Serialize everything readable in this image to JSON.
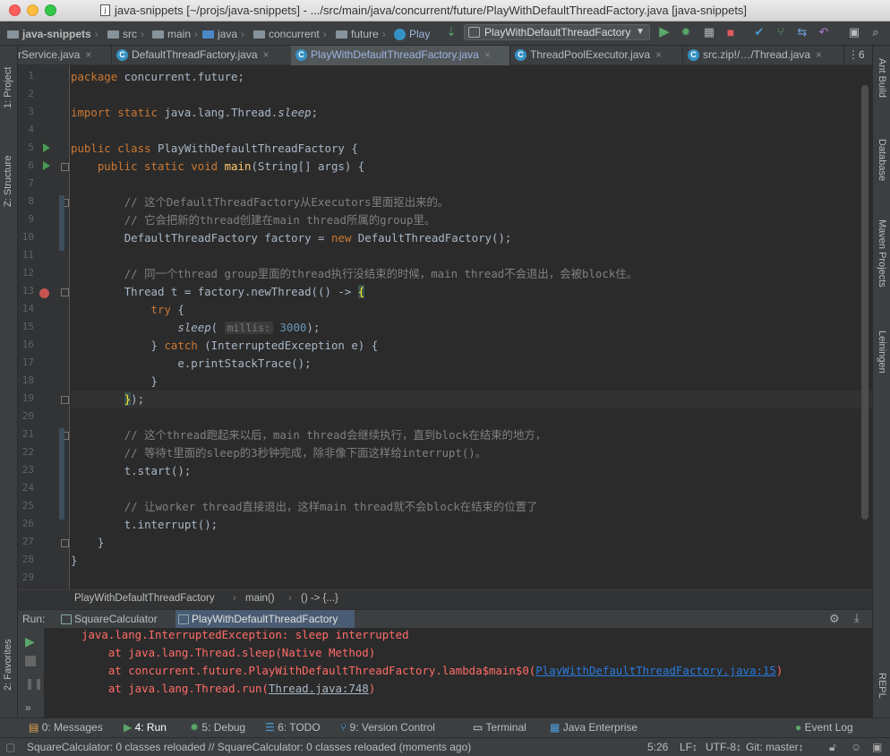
{
  "window": {
    "title": "java-snippets [~/projs/java-snippets] - .../src/main/java/concurrent/future/PlayWithDefaultThreadFactory.java [java-snippets]"
  },
  "navbar": {
    "crumbs": [
      "java-snippets",
      "src",
      "main",
      "java",
      "concurrent",
      "future",
      "Play"
    ],
    "run_config": "PlayWithDefaultThreadFactory"
  },
  "tabs": [
    {
      "label": "rService.java"
    },
    {
      "label": "DefaultThreadFactory.java"
    },
    {
      "label": "PlayWithDefaultThreadFactory.java",
      "active": true
    },
    {
      "label": "ThreadPoolExecutor.java"
    },
    {
      "label": "src.zip!/…/Thread.java"
    },
    {
      "label": "⋮6"
    }
  ],
  "left_strip": {
    "project": "1: Project",
    "structure": "Z: Structure",
    "favorites": "2: Favorites"
  },
  "right_strip": {
    "ant": "Ant Build",
    "database": "Database",
    "maven": "Maven Projects",
    "lein": "Leiningen",
    "repl": "REPL"
  },
  "editor": {
    "line_numbers": [
      "1",
      "2",
      "3",
      "4",
      "5",
      "6",
      "7",
      "8",
      "9",
      "10",
      "11",
      "12",
      "13",
      "14",
      "15",
      "16",
      "17",
      "18",
      "19",
      "20",
      "21",
      "22",
      "23",
      "24",
      "25",
      "26",
      "27",
      "28",
      "29"
    ],
    "code": {
      "l1_kw": "package",
      "l1_rest": " concurrent.future;",
      "l3_kw": "import static",
      "l3_rest": " java.lang.Thread.",
      "l3_it": "sleep",
      "l3_end": ";",
      "l5_kw": "public class",
      "l5_rest": " PlayWithDefaultThreadFactory {",
      "l6_kw": "public static void",
      "l6_fn": "main",
      "l6_rest": "(String[] args) {",
      "l8": "// 这个DefaultThreadFactory从Executors里面抠出来的。",
      "l9": "// 它会把新的thread创建在main thread所属的group里。",
      "l10_a": "DefaultThreadFactory factory = ",
      "l10_kw": "new",
      "l10_b": " DefaultThreadFactory();",
      "l12": "// 同一个thread group里面的thread执行没结束的时候，main thread不会退出，会被block住。",
      "l13_a": "Thread t = factory.newThread(() -> ",
      "l13_b": "{",
      "l14_kw": "try",
      "l14_rest": " {",
      "l15_it": "sleep",
      "l15_a": "(",
      "l15_hint": "millis:",
      "l15_num": "3000",
      "l15_b": ");",
      "l16_a": "} ",
      "l16_kw": "catch",
      "l16_b": " (InterruptedException e) {",
      "l17": "e.printStackTrace();",
      "l18": "}",
      "l19_a": "}",
      "l19_b": ");",
      "l21": "// 这个thread跑起来以后，main thread会继续执行，直到block在结束的地方，",
      "l22": "// 等待t里面的sleep的3秒钟完成，除非像下面这样给interrupt()。",
      "l23": "t.start();",
      "l25": "// 让worker thread直接退出，这样main thread就不会block在结束的位置了",
      "l26": "t.interrupt();",
      "l27": "}",
      "l28": "}"
    }
  },
  "editor_breadcrumb": [
    "PlayWithDefaultThreadFactory",
    "main()",
    "() -> {...}"
  ],
  "run_panel": {
    "label": "Run:",
    "tabs": [
      "SquareCalculator",
      "PlayWithDefaultThreadFactory"
    ],
    "console": {
      "line1": "java.lang.InterruptedException: sleep interrupted",
      "line2": "    at java.lang.Thread.sleep(Native Method)",
      "line3_a": "    at concurrent.future.PlayWithDefaultThreadFactory.lambda$main$0(",
      "line3_link": "PlayWithDefaultThreadFactory.java:15",
      "line3_b": ")",
      "line4_a": "    at java.lang.Thread.run(",
      "line4_link": "Thread.java:748",
      "line4_b": ")"
    }
  },
  "toolwindows": {
    "messages": "0: Messages",
    "run": "4: Run",
    "debug": "5: Debug",
    "todo": "6: TODO",
    "vcs": "9: Version Control",
    "terminal": "Terminal",
    "java_ee": "Java Enterprise",
    "event_log": "Event Log"
  },
  "status": {
    "message": "SquareCalculator: 0 classes reloaded // SquareCalculator: 0 classes reloaded (moments ago)",
    "position": "5:26",
    "line_sep": "LF↕",
    "encoding": "UTF-8↕",
    "git": "Git: master↕"
  },
  "colors": {
    "keyword": "#cc7832",
    "comment": "#808080",
    "error": "#ff6b68",
    "link": "#287bde",
    "run_green": "#499c54"
  }
}
